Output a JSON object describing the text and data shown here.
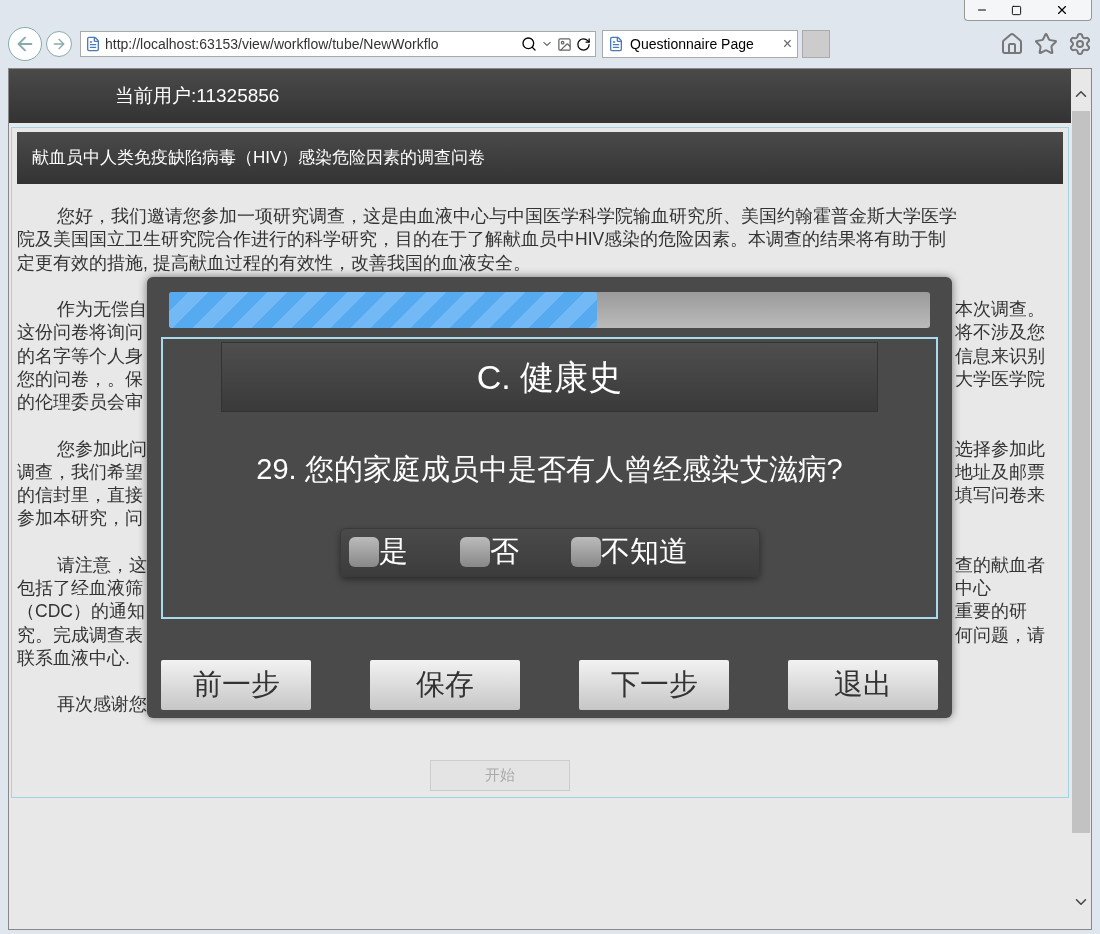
{
  "browser": {
    "url": "http://localhost:63153/view/workflow/tube/NewWorkflo",
    "tab": {
      "title": "Questionnaire Page",
      "close": "×"
    }
  },
  "header": {
    "user": "当前用户:11325856"
  },
  "page": {
    "title": "献血员中人类免疫缺陷病毒（HIV）感染危险因素的调查问卷",
    "paragraphs": [
      {
        "lines": [
          {
            "left": "您好，我们邀请您参加一项研究调查，这是由血液中心与中国医学科学院输血研究所、美国约翰霍普金斯大学医学"
          },
          {
            "left": "院及美国国立卫生研究院合作进行的科学研究，目的在于了解献血员中HIV感染的危险因素。本调查的结果将有助于制"
          },
          {
            "left": "定更有效的措施, 提高献血过程的有效性，改善我国的血液安全。"
          }
        ]
      },
      {
        "lines": [
          {
            "left": "作为无偿自",
            "right": "本次调查。"
          },
          {
            "left": "这份问卷将询问",
            "right": "将不涉及您"
          },
          {
            "left": "的名字等个人身",
            "right": "信息来识别"
          },
          {
            "left": "您的问卷，。保",
            "right": "大学医学院"
          },
          {
            "left": "的伦理委员会审"
          }
        ]
      },
      {
        "lines": [
          {
            "left": "您参加此问",
            "right": "选择参加此"
          },
          {
            "left": "调查，我们希望",
            "right": "地址及邮票"
          },
          {
            "left": "的信封里，直接",
            "right": "填写问卷来"
          },
          {
            "left": "参加本研究，问"
          }
        ]
      },
      {
        "lines": [
          {
            "left": "请注意，这",
            "right": "查的献血者"
          },
          {
            "left": "包括了经血液筛",
            "right": "中心"
          },
          {
            "left": "（CDC）的通知",
            "right": "重要的研"
          },
          {
            "left": "究。完成调查表",
            "right": "何问题，请"
          },
          {
            "left": "联系血液中心."
          }
        ]
      },
      {
        "lines": [
          {
            "left": "再次感谢您"
          }
        ]
      }
    ],
    "start_button": {
      "label": "开始",
      "disabled": true
    }
  },
  "modal": {
    "progress": {
      "level": 0.563
    },
    "section": "C. 健康史",
    "question": "29. 您的家庭成员中是否有人曾经感染艾滋病?",
    "options": [
      {
        "label": "是",
        "checked": false
      },
      {
        "label": "否",
        "checked": false
      },
      {
        "label": "不知道",
        "checked": false
      }
    ],
    "buttons": [
      "前一步",
      "保存",
      "下一步",
      "退出"
    ]
  }
}
